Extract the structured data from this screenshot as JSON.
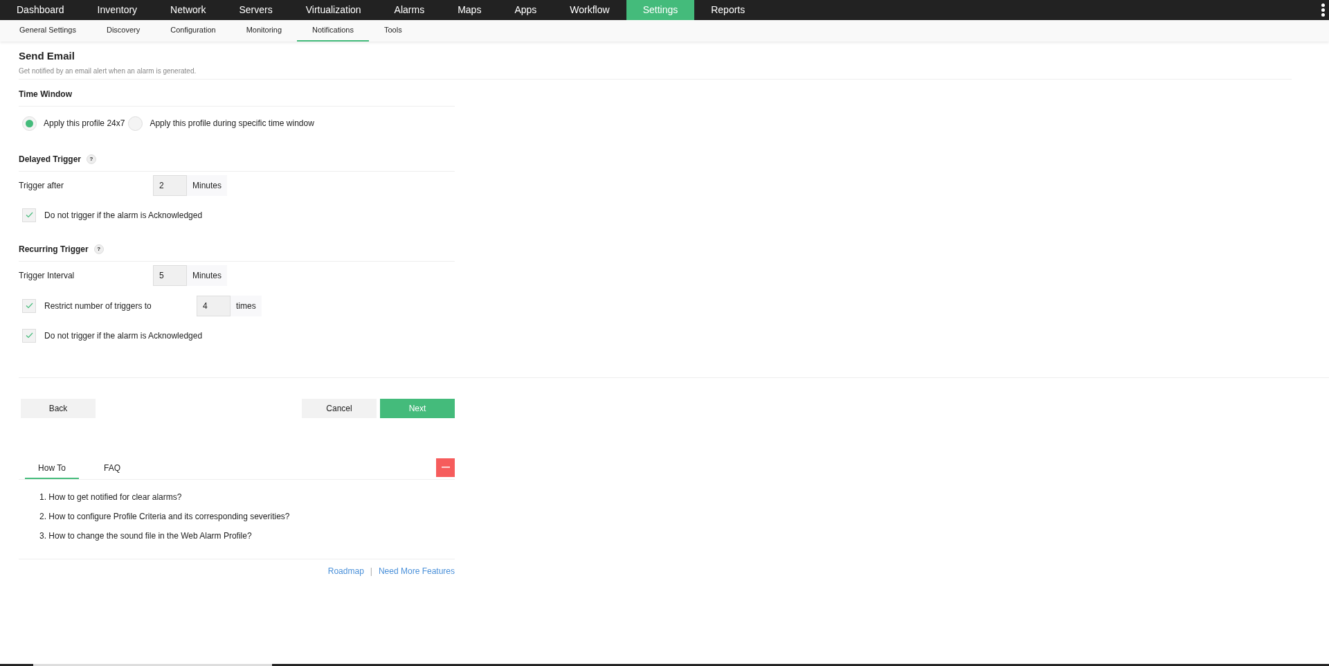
{
  "top_nav": [
    {
      "label": "Dashboard",
      "selected": false
    },
    {
      "label": "Inventory",
      "selected": false
    },
    {
      "label": "Network",
      "selected": false
    },
    {
      "label": "Servers",
      "selected": false
    },
    {
      "label": "Virtualization",
      "selected": false
    },
    {
      "label": "Alarms",
      "selected": false
    },
    {
      "label": "Maps",
      "selected": false
    },
    {
      "label": "Apps",
      "selected": false
    },
    {
      "label": "Workflow",
      "selected": false
    },
    {
      "label": "Settings",
      "selected": true
    },
    {
      "label": "Reports",
      "selected": false
    }
  ],
  "sub_nav": [
    {
      "label": "General Settings",
      "selected": false
    },
    {
      "label": "Discovery",
      "selected": false
    },
    {
      "label": "Configuration",
      "selected": false
    },
    {
      "label": "Monitoring",
      "selected": false
    },
    {
      "label": "Notifications",
      "selected": true
    },
    {
      "label": "Tools",
      "selected": false
    }
  ],
  "page": {
    "title": "Send Email",
    "subtitle": "Get notified by an email alert when an alarm is generated."
  },
  "time_window": {
    "heading": "Time Window",
    "options": [
      {
        "label": "Apply this profile 24x7",
        "selected": true
      },
      {
        "label": "Apply this profile during specific time window",
        "selected": false
      }
    ]
  },
  "delayed_trigger": {
    "heading": "Delayed Trigger",
    "help": "?",
    "rows": [
      {
        "kind": "field",
        "label": "Trigger after",
        "value": "2",
        "unit": "Minutes"
      },
      {
        "kind": "checkbox",
        "label": "Do not trigger if the alarm is Acknowledged",
        "checked": true
      }
    ]
  },
  "recurring_trigger": {
    "heading": "Recurring Trigger",
    "help": "?",
    "rows": [
      {
        "kind": "field",
        "label": "Trigger Interval",
        "value": "5",
        "unit": "Minutes"
      },
      {
        "kind": "checkfield",
        "label": "Restrict number of triggers to",
        "checked": true,
        "value": "4",
        "unit": "times"
      },
      {
        "kind": "checkbox",
        "label": "Do not trigger if the alarm is Acknowledged",
        "checked": true
      }
    ]
  },
  "buttons": {
    "back": "Back",
    "cancel": "Cancel",
    "next": "Next"
  },
  "help": {
    "tabs": [
      {
        "label": "How To",
        "selected": true
      },
      {
        "label": "FAQ",
        "selected": false
      }
    ],
    "items": [
      "1. How to get notified for clear alarms?",
      "2. How to configure Profile Criteria and its corresponding severities?",
      "3. How to change the sound file in the Web Alarm Profile?"
    ],
    "links": [
      "Roadmap",
      "Need More Features"
    ],
    "separator": "|"
  }
}
